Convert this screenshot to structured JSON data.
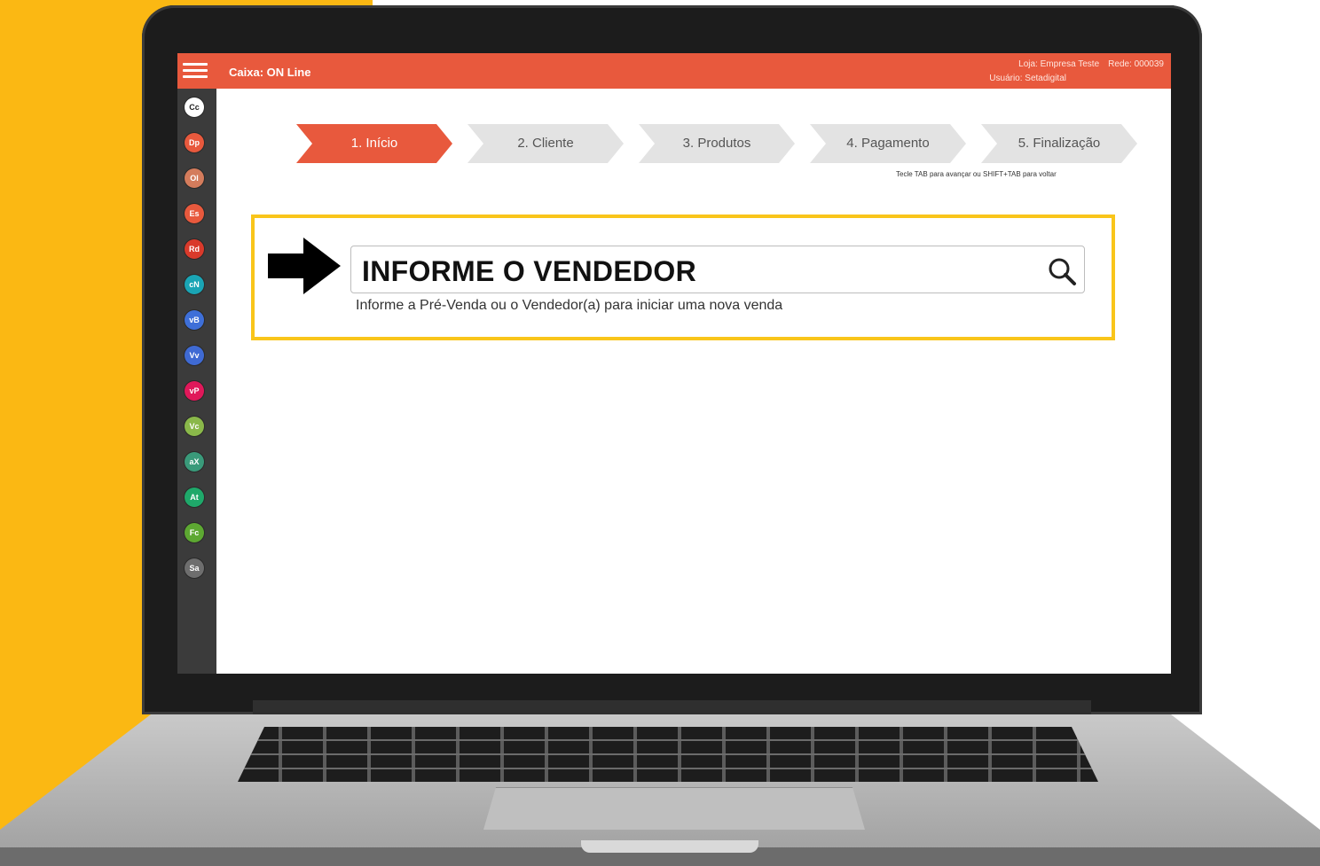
{
  "header": {
    "title": "Caixa: ON Line",
    "store": "Loja: Empresa Teste",
    "network": "Rede: 000039",
    "user": "Usuário: Setadigital"
  },
  "sidebar": {
    "items": [
      {
        "label": "Cc",
        "color": "#ffffff"
      },
      {
        "label": "Dp",
        "color": "#e8593d"
      },
      {
        "label": "Ol",
        "color": "#d47c5c"
      },
      {
        "label": "Es",
        "color": "#e8593d"
      },
      {
        "label": "Rd",
        "color": "#d93a2b"
      },
      {
        "label": "cN",
        "color": "#1aa5b5"
      },
      {
        "label": "vB",
        "color": "#3e6fd8"
      },
      {
        "label": "Vv",
        "color": "#3f6ad3"
      },
      {
        "label": "vP",
        "color": "#e0185a"
      },
      {
        "label": "Vc",
        "color": "#8ab84a"
      },
      {
        "label": "aX",
        "color": "#3a9a7a"
      },
      {
        "label": "At",
        "color": "#1fa86a"
      },
      {
        "label": "Fc",
        "color": "#5da832"
      },
      {
        "label": "Sa",
        "color": "#6e6e6e"
      }
    ]
  },
  "steps": [
    {
      "label": "1. Início",
      "active": true
    },
    {
      "label": "2. Cliente",
      "active": false
    },
    {
      "label": "3. Produtos",
      "active": false
    },
    {
      "label": "4. Pagamento",
      "active": false
    },
    {
      "label": "5. Finalização",
      "active": false
    }
  ],
  "tab_hint": "Tecle TAB para avançar ou SHIFT+TAB para voltar",
  "search": {
    "value": "INFORME O VENDEDOR",
    "help": "Informe a Pré-Venda ou o Vendedor(a) para iniciar uma nova venda"
  },
  "colors": {
    "accent": "#e8593d",
    "highlight": "#f9c51a",
    "background": "#fbb813"
  },
  "icons": {
    "menu": "hamburger-icon",
    "search": "magnifier-icon",
    "pointer": "right-arrow-icon"
  }
}
